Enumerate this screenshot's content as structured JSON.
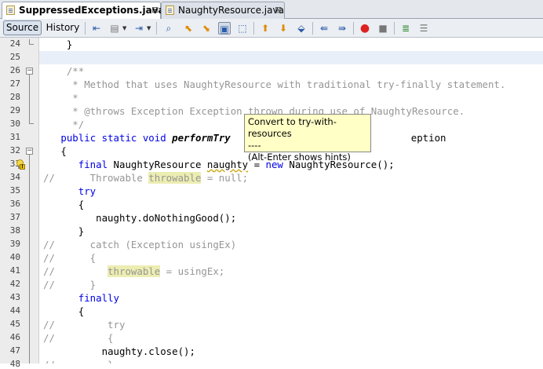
{
  "tabs": [
    {
      "label": "SuppressedExceptions.java",
      "close": "⊠",
      "active": true
    },
    {
      "label": "NaughtyResource.java",
      "close": "⊠",
      "active": false
    }
  ],
  "toolbar": {
    "source_label": "Source",
    "history_label": "History",
    "icons": [
      "back-history-icon",
      "last-edit-icon",
      "forward-icon",
      "find-icon",
      "find-previous-icon",
      "find-next-icon",
      "toggle-highlight-icon",
      "rectangular-selection-icon",
      "previous-bookmark-icon",
      "next-bookmark-icon",
      "toggle-bookmark-icon",
      "shift-left-icon",
      "shift-right-icon",
      "start-macro-icon",
      "stop-macro-icon",
      "comment-icon",
      "uncomment-icon"
    ]
  },
  "editor": {
    "lines": [
      {
        "num": "24",
        "text": "}"
      },
      {
        "num": "25",
        "text": ""
      },
      {
        "num": "26",
        "text": "/**"
      },
      {
        "num": "27",
        "text": " * Method that uses NaughtyResource with traditional try-finally statement."
      },
      {
        "num": "28",
        "text": " *"
      },
      {
        "num": "29",
        "text": " * @throws Exception Exception thrown during use of NaughtyResource."
      },
      {
        "num": "30",
        "text": " */"
      },
      {
        "num": "31",
        "kw1": "public static void ",
        "method": "performTry",
        "rest": "",
        "end": "eption"
      },
      {
        "num": "32",
        "text": "{"
      },
      {
        "num": "33",
        "kw1": "final",
        "mid": " NaughtyResource ",
        "var": "naughty",
        "mid2": " = ",
        "kw2": "new",
        "end": " NaughtyResource();"
      },
      {
        "num": "34",
        "prefix": "//",
        "pre": "      Throwable ",
        "var": "throwable",
        "end": " = null;"
      },
      {
        "num": "35",
        "text": "try"
      },
      {
        "num": "36",
        "text": "{"
      },
      {
        "num": "37",
        "text": "naughty.doNothingGood();"
      },
      {
        "num": "38",
        "text": "}"
      },
      {
        "num": "39",
        "prefix": "//",
        "text": "      catch (Exception usingEx)"
      },
      {
        "num": "40",
        "prefix": "//",
        "text": "      {"
      },
      {
        "num": "41",
        "prefix": "//",
        "pre": "         ",
        "var": "throwable",
        "end": " = usingEx;"
      },
      {
        "num": "42",
        "prefix": "//",
        "text": "      }"
      },
      {
        "num": "43",
        "text": "finally"
      },
      {
        "num": "44",
        "text": "{"
      },
      {
        "num": "45",
        "prefix": "//",
        "text": "         try"
      },
      {
        "num": "46",
        "prefix": "//",
        "text": "         {"
      },
      {
        "num": "47",
        "text": "naughty.close();"
      },
      {
        "num": "48",
        "prefix": "//",
        "text": "         }"
      }
    ]
  },
  "tooltip": {
    "line1": "Convert to try-with-resources",
    "line2": "----",
    "line3": "(Alt-Enter shows hints)"
  }
}
